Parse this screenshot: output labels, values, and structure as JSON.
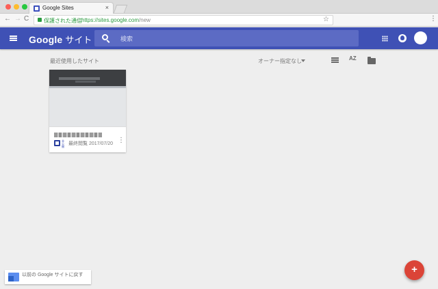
{
  "browser": {
    "tab_title": "Google Sites",
    "tab_close": "×",
    "nav_back": "←",
    "nav_forward": "→",
    "nav_reload": "C",
    "secure_label": "保護された通信",
    "url_prefix": "https://sites.google.com",
    "url_path": "/new",
    "bookmark_star": "☆",
    "menu": "⋮"
  },
  "appbar": {
    "brand_google": "Google",
    "brand_sites": "サイト",
    "search_placeholder": "検索"
  },
  "toolbar": {
    "section_title": "最近使用したサイト",
    "owner_filter": "オーナー指定なし",
    "sort_label": "AZ"
  },
  "sites": [
    {
      "badge": "非公開",
      "meta": "最終閲覧 2017/07/20",
      "more": "⋮"
    }
  ],
  "legacy": {
    "label": "以前の Google サイトに戻す"
  },
  "fab": {
    "label": "+"
  },
  "colors": {
    "appbar": "#3f51b5",
    "fab": "#db4437",
    "secure": "#2a9a3f"
  }
}
